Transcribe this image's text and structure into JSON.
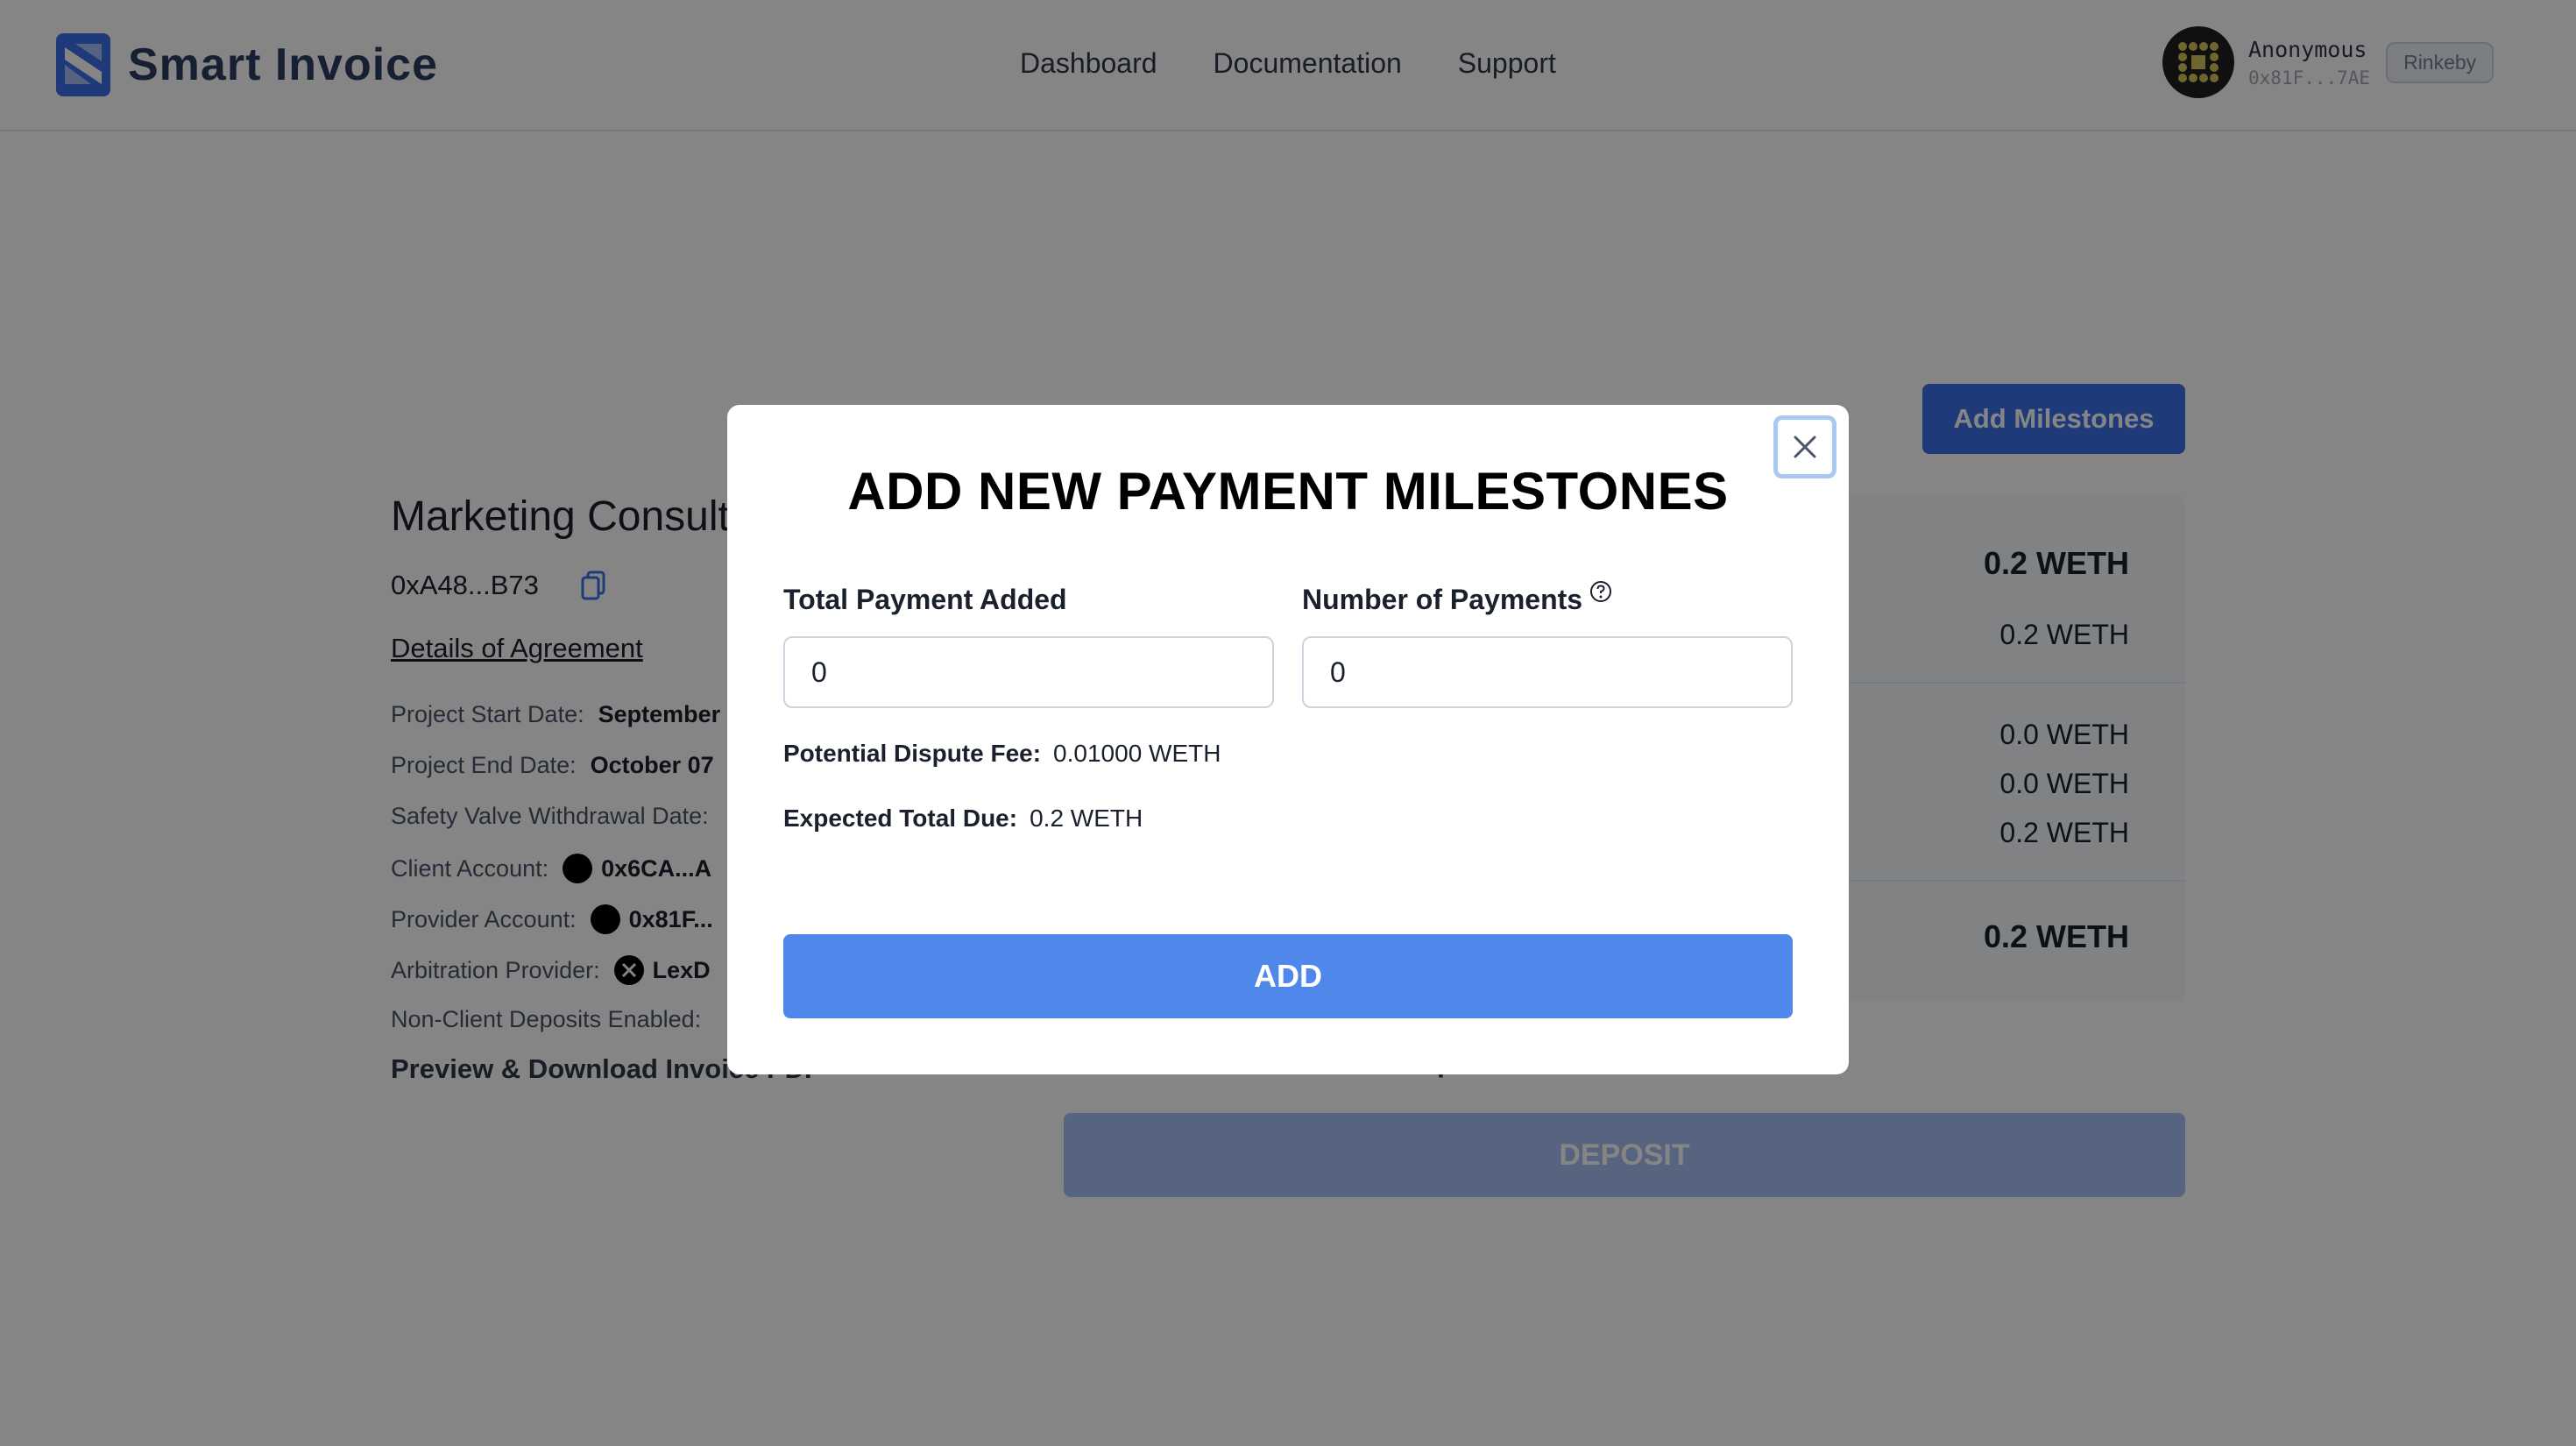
{
  "header": {
    "app_name": "Smart Invoice",
    "nav": [
      "Dashboard",
      "Documentation",
      "Support"
    ],
    "account": {
      "name": "Anonymous",
      "address": "0x81F...7AE",
      "network": "Rinkeby"
    }
  },
  "invoice": {
    "title": "Marketing Consult",
    "address": "0xA48...B73",
    "details_link": "Details of Agreement",
    "details": [
      {
        "label": "Project Start Date:",
        "value": "September"
      },
      {
        "label": "Project End Date:",
        "value": "October 07"
      },
      {
        "label": "Safety Valve Withdrawal Date:",
        "value": ""
      },
      {
        "label": "Client Account:",
        "value": "0x6CA...A"
      },
      {
        "label": "Provider Account:",
        "value": "0x81F..."
      },
      {
        "label": "Arbitration Provider:",
        "value": "LexD"
      },
      {
        "label": "Non-Client Deposits Enabled:",
        "value": ""
      }
    ],
    "preview_link": "Preview & Download Invoice PDF",
    "add_milestones_label": "Add Milestones",
    "amounts": [
      "0.2 WETH",
      "0.2 WETH",
      "0.0 WETH",
      "0.0 WETH",
      "0.2 WETH",
      "0.2 WETH"
    ],
    "deposit_label": "posits",
    "deposit_button": "DEPOSIT"
  },
  "modal": {
    "title": "ADD NEW PAYMENT MILESTONES",
    "total_label": "Total Payment Added",
    "total_value": "0",
    "count_label": "Number of Payments",
    "count_value": "0",
    "dispute_fee_label": "Potential Dispute Fee:",
    "dispute_fee_value": "0.01000 WETH",
    "total_due_label": "Expected Total Due:",
    "total_due_value": "0.2 WETH",
    "add_button": "ADD"
  },
  "colors": {
    "brand": "#3b6fe8",
    "add_button": "#5087ea",
    "overlay": "rgba(0,0,0,0.48)"
  }
}
